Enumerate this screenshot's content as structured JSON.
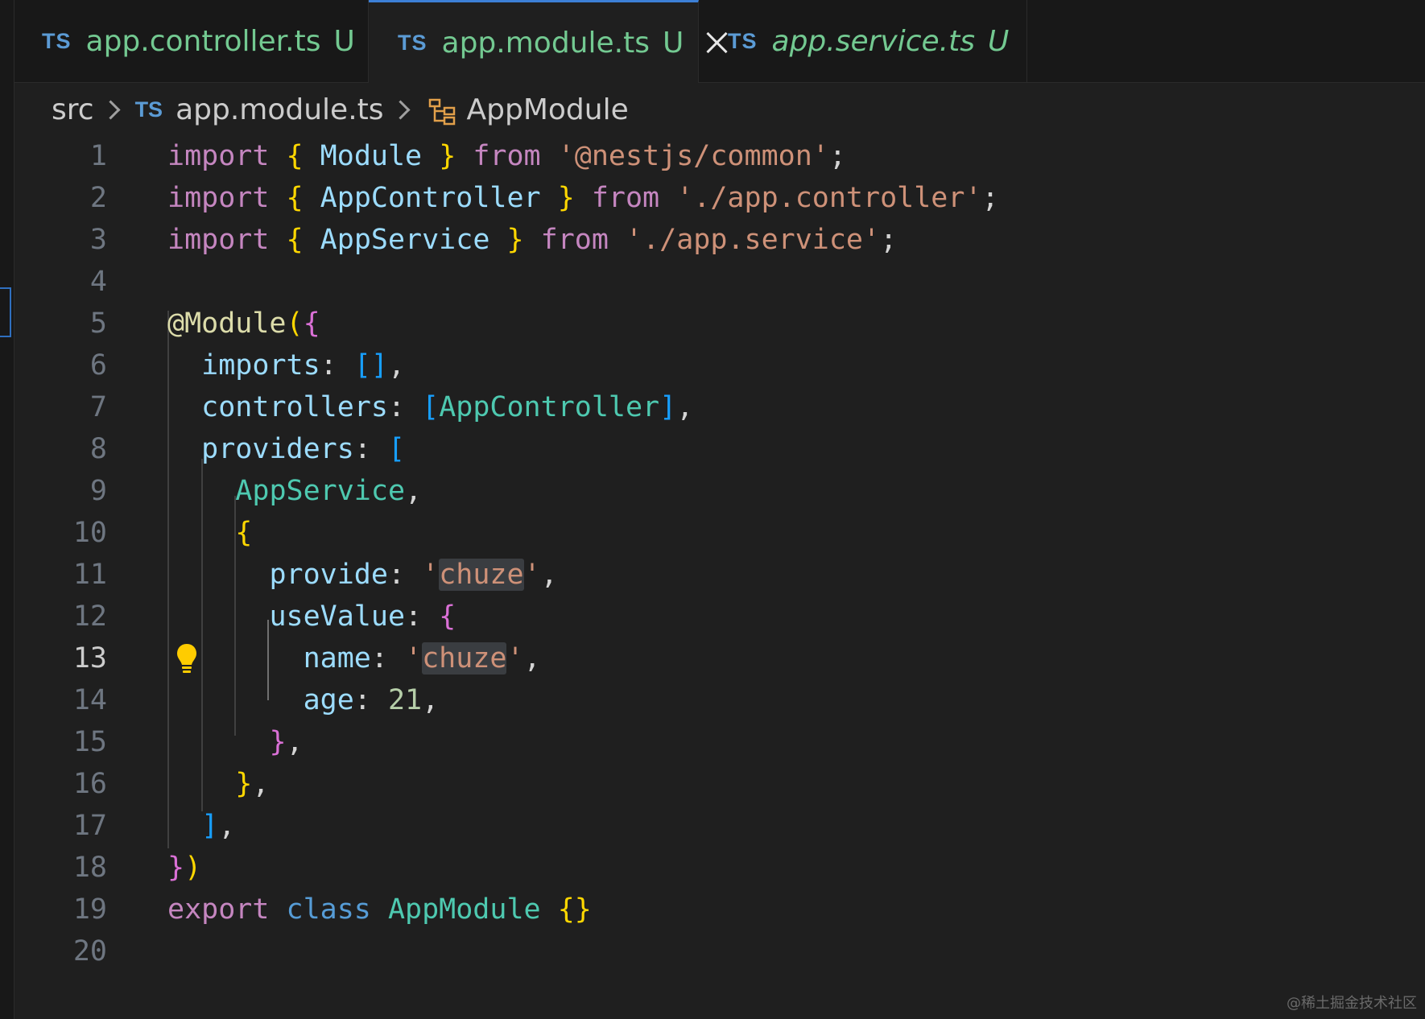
{
  "tabs": [
    {
      "badge": "TS",
      "name": "app.controller.ts",
      "status": "U"
    },
    {
      "badge": "TS",
      "name": "app.module.ts",
      "status": "U"
    },
    {
      "badge": "TS",
      "name": "app.service.ts",
      "status": "U"
    }
  ],
  "breadcrumb": {
    "folder": "src",
    "file_badge": "TS",
    "file": "app.module.ts",
    "symbol": "AppModule"
  },
  "line_numbers": [
    "1",
    "2",
    "3",
    "4",
    "5",
    "6",
    "7",
    "8",
    "9",
    "10",
    "11",
    "12",
    "13",
    "14",
    "15",
    "16",
    "17",
    "18",
    "19",
    "20"
  ],
  "code": {
    "import": "import",
    "from": "from",
    "export": "export",
    "class": "class",
    "module_name": "Module",
    "app_controller": "AppController",
    "app_service": "AppService",
    "app_module": "AppModule",
    "src_common": "'@nestjs/common'",
    "src_controller": "'./app.controller'",
    "src_service": "'./app.service'",
    "decorator": "@Module",
    "imports_key": "imports",
    "controllers_key": "controllers",
    "providers_key": "providers",
    "provide_key": "provide",
    "usevalue_key": "useValue",
    "name_key": "name",
    "age_key": "age",
    "chuze": "chuze",
    "age_value": "21"
  },
  "watermark": "@稀土掘金技术社区",
  "colors": {
    "tab_modified": "#73c991",
    "ts_badge": "#5b9bd5",
    "active_tab_border": "#3c7fd6",
    "editor_bg": "#1f1f1f"
  },
  "icons": [
    "close-icon",
    "chevron-right-icon",
    "module-symbol-icon",
    "lightbulb-icon"
  ]
}
